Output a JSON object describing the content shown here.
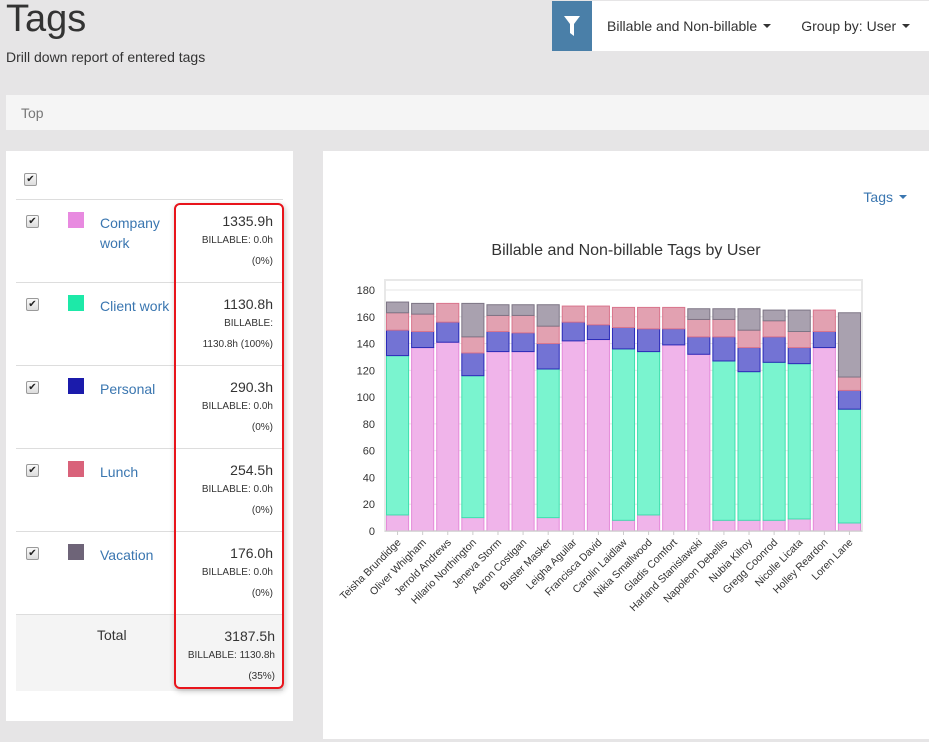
{
  "header": {
    "title": "Tags",
    "subtitle": "Drill down report of entered tags"
  },
  "toolbar": {
    "filter_icon": "filter-icon",
    "billable_filter": "Billable and Non-billable",
    "group_by": "Group by: User"
  },
  "breadcrumb": {
    "items": [
      "Top"
    ]
  },
  "tags_table": {
    "select_all_checked": true,
    "rows": [
      {
        "name": "Company work",
        "color": "#e88ae0",
        "checked": true,
        "hours": "1335.9h",
        "billable": "BILLABLE: 0.0h",
        "billable_pct": "(0%)"
      },
      {
        "name": "Client work",
        "color": "#1de9a8",
        "checked": true,
        "hours": "1130.8h",
        "billable": "BILLABLE:",
        "billable_pct": "1130.8h (100%)"
      },
      {
        "name": "Personal",
        "color": "#1b1bab",
        "checked": true,
        "hours": "290.3h",
        "billable": "BILLABLE: 0.0h",
        "billable_pct": "(0%)"
      },
      {
        "name": "Lunch",
        "color": "#d9627a",
        "checked": true,
        "hours": "254.5h",
        "billable": "BILLABLE: 0.0h",
        "billable_pct": "(0%)"
      },
      {
        "name": "Vacation",
        "color": "#6e6478",
        "checked": true,
        "hours": "176.0h",
        "billable": "BILLABLE: 0.0h",
        "billable_pct": "(0%)"
      }
    ],
    "total": {
      "label": "Total",
      "hours": "3187.5h",
      "billable": "BILLABLE: 1130.8h",
      "billable_pct": "(35%)"
    }
  },
  "chart_panel": {
    "dropdown_label": "Tags"
  },
  "chart_data": {
    "type": "bar",
    "stacked": true,
    "title": "Billable and Non-billable Tags by User",
    "xlabel": "",
    "ylabel": "",
    "ylim": [
      0,
      180
    ],
    "yticks": [
      0,
      20,
      40,
      60,
      80,
      100,
      120,
      140,
      160,
      180
    ],
    "grid": true,
    "legend": "none",
    "categories": [
      "Teisha Brundidge",
      "Oliver Whigham",
      "Jerrold Andrews",
      "Hilario Northington",
      "Jeneva Storm",
      "Aaron Costigan",
      "Buster Masker",
      "Leigha Aguilar",
      "Francisca David",
      "Carolin Laidlaw",
      "Nikia Smallwood",
      "Gladis Comfort",
      "Harland Stanislawski",
      "Napoleon Debellis",
      "Nubia Kilroy",
      "Gregg Coonrod",
      "Nicolle Licata",
      "Holley Reardon",
      "Loren Lane"
    ],
    "series": [
      {
        "name": "Company work",
        "color": "#f0b4ea",
        "stroke": "#e48ad9",
        "values": [
          12,
          137,
          141,
          10,
          134,
          134,
          10,
          142,
          143,
          8,
          12,
          139,
          132,
          8,
          8,
          8,
          9,
          137,
          6
        ]
      },
      {
        "name": "Client work",
        "color": "#7af4cf",
        "stroke": "#3fdfae",
        "values": [
          119,
          0,
          0,
          106,
          0,
          0,
          111,
          0,
          0,
          128,
          122,
          0,
          0,
          119,
          111,
          118,
          116,
          0,
          85
        ]
      },
      {
        "name": "Personal",
        "color": "#7373d4",
        "stroke": "#2a2ab8",
        "values": [
          19,
          12,
          15,
          17,
          15,
          14,
          19,
          14,
          11,
          16,
          17,
          12,
          13,
          18,
          18,
          19,
          12,
          12,
          14
        ]
      },
      {
        "name": "Lunch",
        "color": "#e2a1b1",
        "stroke": "#d9758d",
        "values": [
          13,
          13,
          14,
          12,
          12,
          13,
          13,
          12,
          14,
          15,
          16,
          16,
          13,
          13,
          13,
          12,
          12,
          16,
          10
        ]
      },
      {
        "name": "Vacation",
        "color": "#a9a1af",
        "stroke": "#7d7585",
        "values": [
          8,
          8,
          0,
          25,
          8,
          8,
          16,
          0,
          0,
          0,
          0,
          0,
          8,
          8,
          16,
          8,
          16,
          0,
          48
        ]
      }
    ]
  }
}
